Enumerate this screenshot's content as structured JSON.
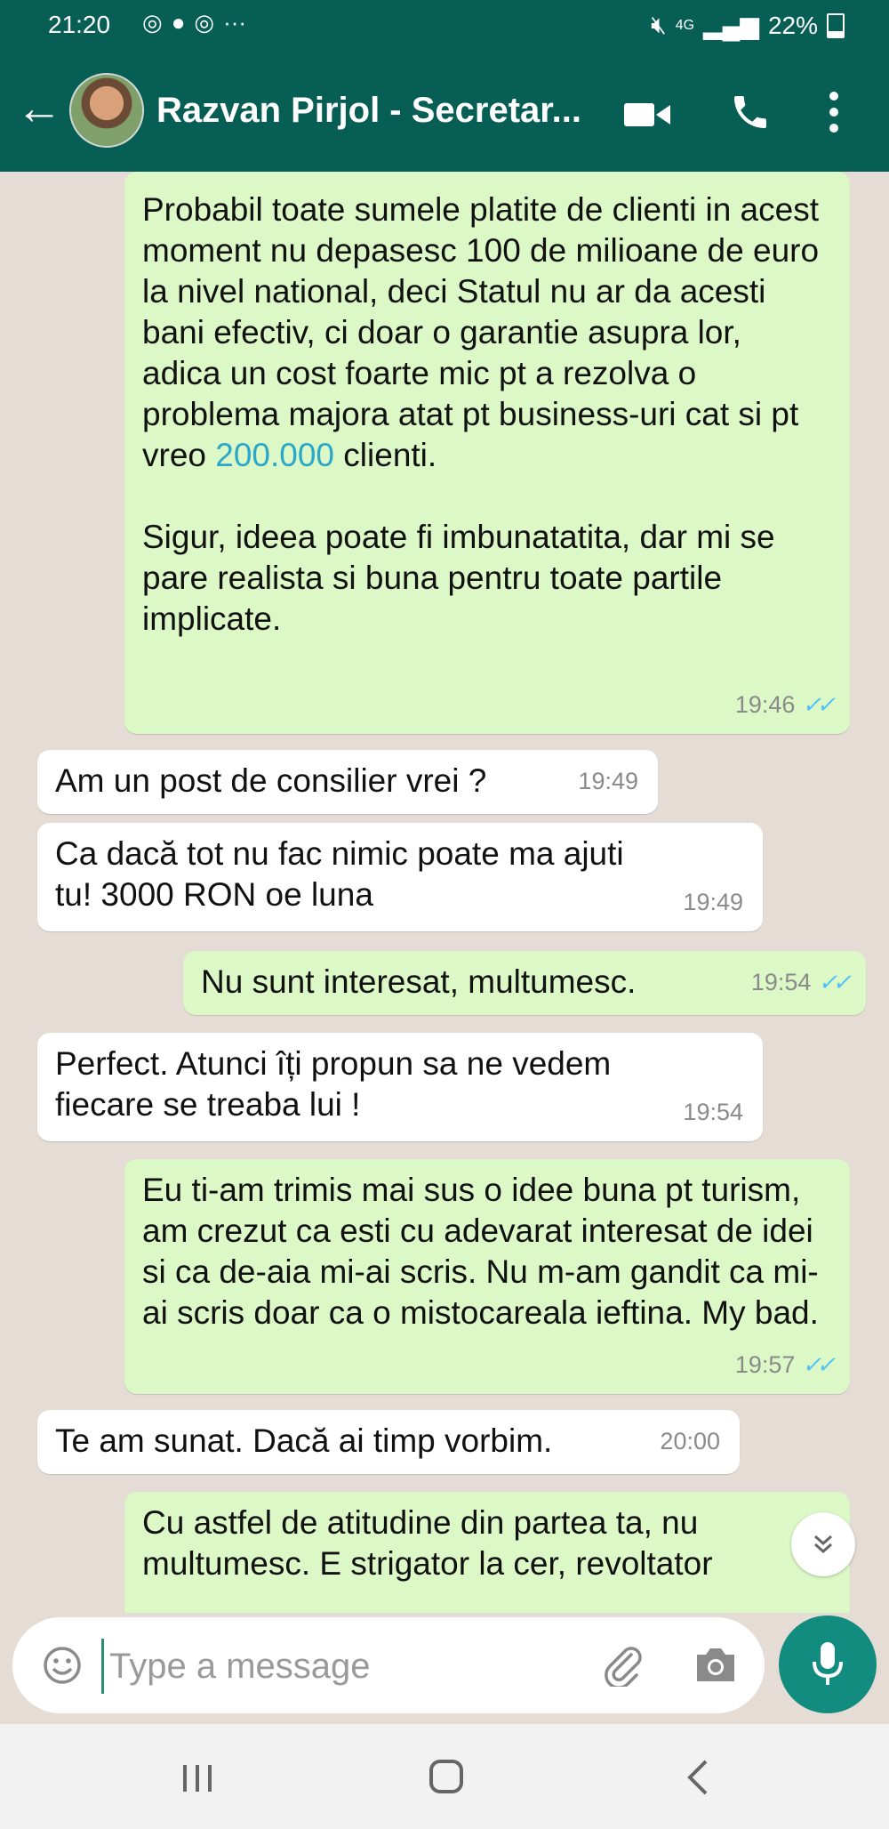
{
  "status_bar": {
    "time": "21:20",
    "notification_icons": [
      "instagram-icon",
      "messenger-icon",
      "instagram-icon"
    ],
    "more": "···",
    "network": "4G",
    "battery": "22%"
  },
  "header": {
    "contact_name": "Razvan Pirjol - Secretar..."
  },
  "messages": [
    {
      "direction": "out",
      "paragraphs": [
        " Probabil toate sumele platite de clienti in acest moment nu depasesc 100 de milioane de euro la nivel national, deci Statul nu ar da acesti bani efectiv, ci doar o garantie asupra lor, adica un cost foarte mic pt a rezolva o problema majora atat pt business-uri cat si pt vreo ",
        "Sigur, ideea poate fi imbunatatita, dar mi se pare realista si buna pentru toate partile implicate."
      ],
      "link": "200.000",
      "after_link": " clienti.",
      "time": "19:46"
    },
    {
      "direction": "in",
      "text": "Am un post de consilier vrei ?",
      "time": "19:49"
    },
    {
      "direction": "in",
      "text": "Ca dacă tot nu fac nimic poate ma ajuti tu! 3000 RON oe luna",
      "time": "19:49"
    },
    {
      "direction": "out",
      "text": "Nu sunt interesat, multumesc.",
      "time": "19:54"
    },
    {
      "direction": "in",
      "text": "Perfect. Atunci îți propun sa ne vedem fiecare se treaba lui !",
      "time": "19:54"
    },
    {
      "direction": "out",
      "text": "Eu ti-am trimis mai sus o idee buna pt turism, am crezut ca esti cu adevarat interesat de idei si ca de-aia mi-ai scris. Nu m-am gandit ca mi-ai scris doar ca o mistocareala ieftina. My bad.",
      "time": "19:57"
    },
    {
      "direction": "in",
      "text": "Te am sunat. Dacă ai timp vorbim.",
      "time": "20:00"
    },
    {
      "direction": "out",
      "text": "Cu astfel de atitudine din partea ta, nu multumesc. E strigator la cer, revoltator"
    }
  ],
  "composer": {
    "placeholder": "Type a message"
  },
  "colors": {
    "header": "#075e54",
    "outgoing_bubble": "#dcf8c6",
    "incoming_bubble": "#ffffff",
    "read_ticks": "#4fc3f7",
    "mic_button": "#128c7e"
  }
}
